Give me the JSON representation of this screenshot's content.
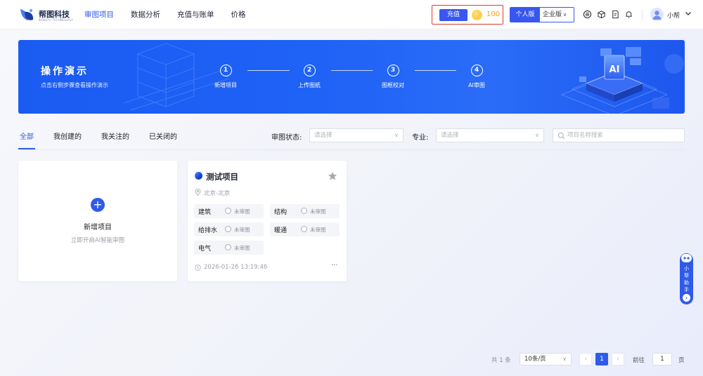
{
  "header": {
    "brand_name": "帮图科技",
    "brand_sub": "BANGTU TECHNOLOGY",
    "nav": [
      {
        "label": "审图项目",
        "active": true
      },
      {
        "label": "数据分析",
        "active": false
      },
      {
        "label": "充值与账单",
        "active": false
      },
      {
        "label": "价格",
        "active": false
      }
    ],
    "recharge_label": "充值",
    "coin_value": "100",
    "edition_personal": "个人版",
    "edition_enterprise": "企业版",
    "username": "小帮",
    "icons": [
      "service-icon",
      "cube-icon",
      "edit-doc-icon",
      "bell-icon"
    ]
  },
  "banner": {
    "title": "操作演示",
    "subtitle": "点击右侧步骤查看操作演示",
    "steps": [
      {
        "num": "1",
        "label": "新增项目"
      },
      {
        "num": "2",
        "label": "上传图纸"
      },
      {
        "num": "3",
        "label": "图框校对"
      },
      {
        "num": "4",
        "label": "AI审图"
      }
    ]
  },
  "filters": {
    "tabs": [
      {
        "label": "全部",
        "active": true
      },
      {
        "label": "我创建的",
        "active": false
      },
      {
        "label": "我关注的",
        "active": false
      },
      {
        "label": "已关闭的",
        "active": false
      }
    ],
    "status_label": "审图状态:",
    "status_placeholder": "请选择",
    "major_label": "专业:",
    "major_placeholder": "请选择",
    "search_placeholder": "项目名称搜索"
  },
  "new_project": {
    "title": "新增项目",
    "subtitle": "立即开启AI智能审图"
  },
  "projects": [
    {
      "name": "测试项目",
      "location": "北京-北京",
      "disciplines": [
        {
          "name": "建筑",
          "status": "未审图"
        },
        {
          "name": "结构",
          "status": "未审图"
        },
        {
          "name": "给排水",
          "status": "未审图"
        },
        {
          "name": "暖通",
          "status": "未审图"
        },
        {
          "name": "电气",
          "status": "未审图"
        }
      ],
      "time": "2026-01-26 13:19:46",
      "more": "···"
    }
  ],
  "assistant": {
    "label": "小帮助手"
  },
  "pagination": {
    "total": "共 1 条",
    "page_size": "10条/页",
    "current": "1",
    "goto_label": "前往",
    "goto_value": "1",
    "page_suffix": "页"
  },
  "colors": {
    "primary": "#2f5bea",
    "banner": "#1f62f6",
    "coin": "#f4b400",
    "highlight_border": "#e53935"
  }
}
